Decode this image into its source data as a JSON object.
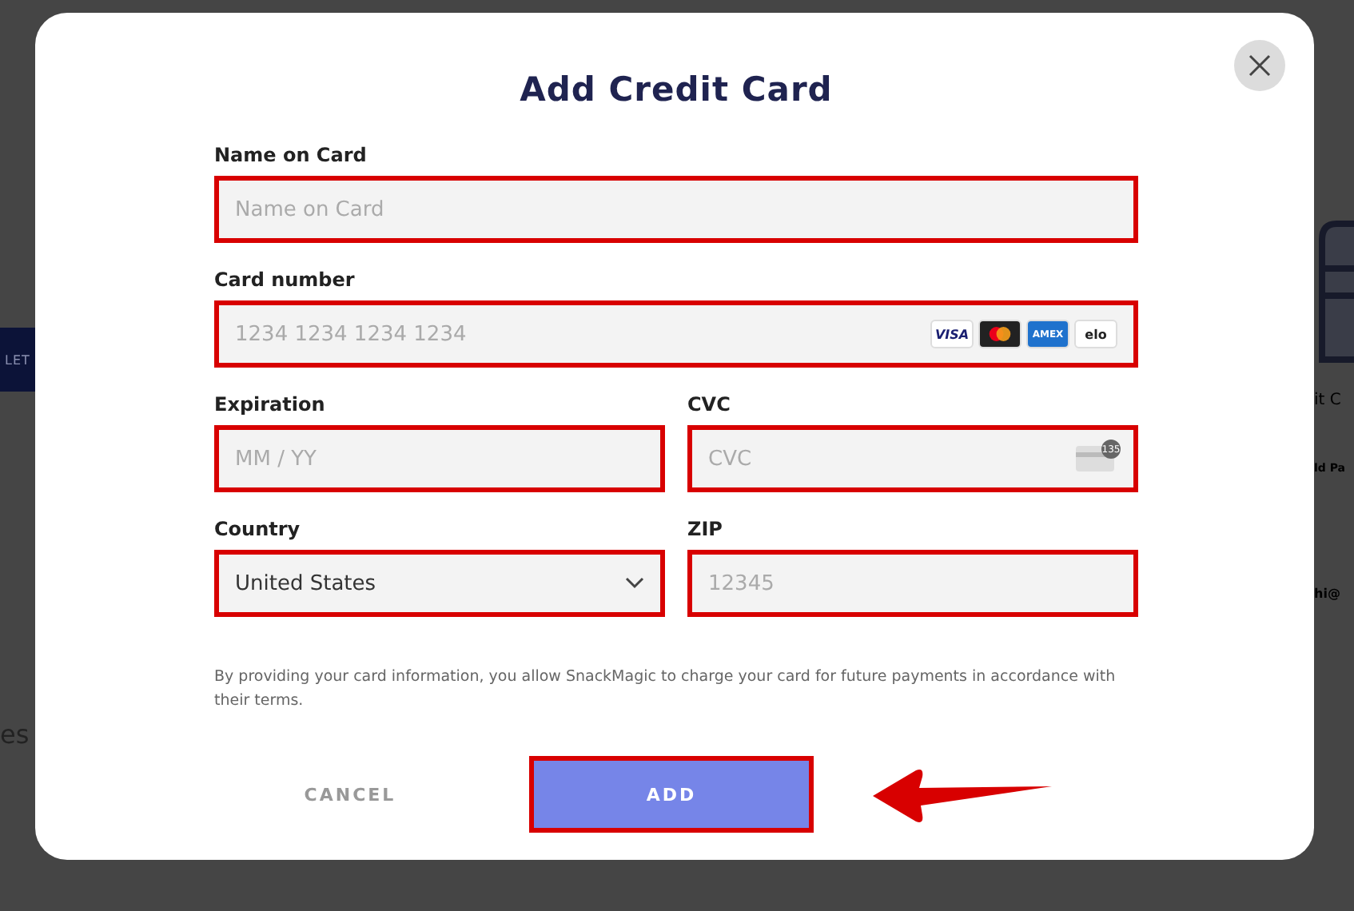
{
  "background": [
    {
      "kind": "button",
      "text": "LET"
    },
    {
      "kind": "text",
      "text": "es"
    },
    {
      "kind": "card-icon"
    },
    {
      "kind": "heading",
      "text": "it C"
    },
    {
      "kind": "link",
      "text": "ld Pa"
    },
    {
      "kind": "text",
      "text": "hi@"
    }
  ],
  "dialog": {
    "title": "Add Credit Card",
    "fields": [
      {
        "kind": "text",
        "label": "Name on Card",
        "placeholder": "Name on Card",
        "highlighted": true
      },
      {
        "kind": "card",
        "label": "Card number",
        "placeholder": "1234 1234 1234 1234",
        "highlighted": true,
        "brands": [
          {
            "kind": "visa",
            "label": "VISA"
          },
          {
            "kind": "mastercard"
          },
          {
            "kind": "amex",
            "label": "AMEX"
          },
          {
            "kind": "elo",
            "label": "elo"
          }
        ]
      },
      {
        "kind": "text",
        "label": "Expiration",
        "placeholder": "MM / YY",
        "highlighted": true
      },
      {
        "kind": "cvc",
        "label": "CVC",
        "placeholder": "CVC",
        "highlighted": true,
        "icon_text": "135"
      },
      {
        "kind": "select",
        "label": "Country",
        "value": "United States",
        "highlighted": true
      },
      {
        "kind": "text",
        "label": "ZIP",
        "placeholder": "12345",
        "highlighted": true
      }
    ],
    "disclaimer": "By providing your card information, you allow SnackMagic to charge your card for future payments in accordance with their terms.",
    "buttons": [
      {
        "kind": "cancel",
        "label": "CANCEL",
        "highlighted": false
      },
      {
        "kind": "primary",
        "label": "ADD",
        "highlighted": true
      }
    ],
    "annotation_arrow": true
  }
}
